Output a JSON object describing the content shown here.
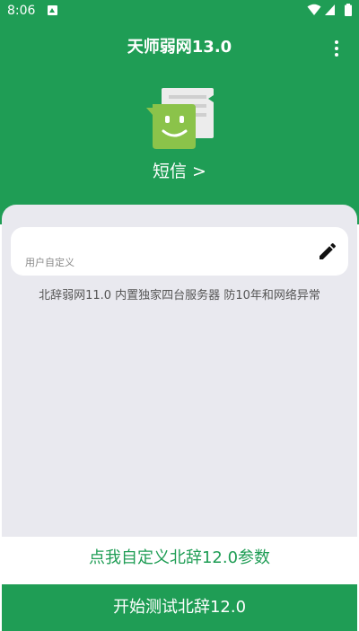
{
  "status_bar": {
    "time": "8:06",
    "icons": [
      "app-notification-icon",
      "wifi-icon",
      "signal-icon",
      "battery-icon"
    ]
  },
  "header": {
    "title": "天师弱网13.0",
    "menu_icon": "more-vert-icon"
  },
  "hero": {
    "icon": "sms-chat-bubble-icon",
    "label": "短信 >"
  },
  "input": {
    "value": "",
    "hint": "用户自定义",
    "edit_icon": "pencil-icon"
  },
  "description": "北辞弱网11.0 内置独家四台服务器 防10年和网络异常",
  "actions": {
    "customize_label": "点我自定义北辞12.0参数",
    "start_label": "开始测试北辞12.0"
  },
  "colors": {
    "primary": "#1f9d55",
    "panel": "#e9e9ef",
    "card": "#ffffff",
    "icon_green": "#8bc34a"
  }
}
